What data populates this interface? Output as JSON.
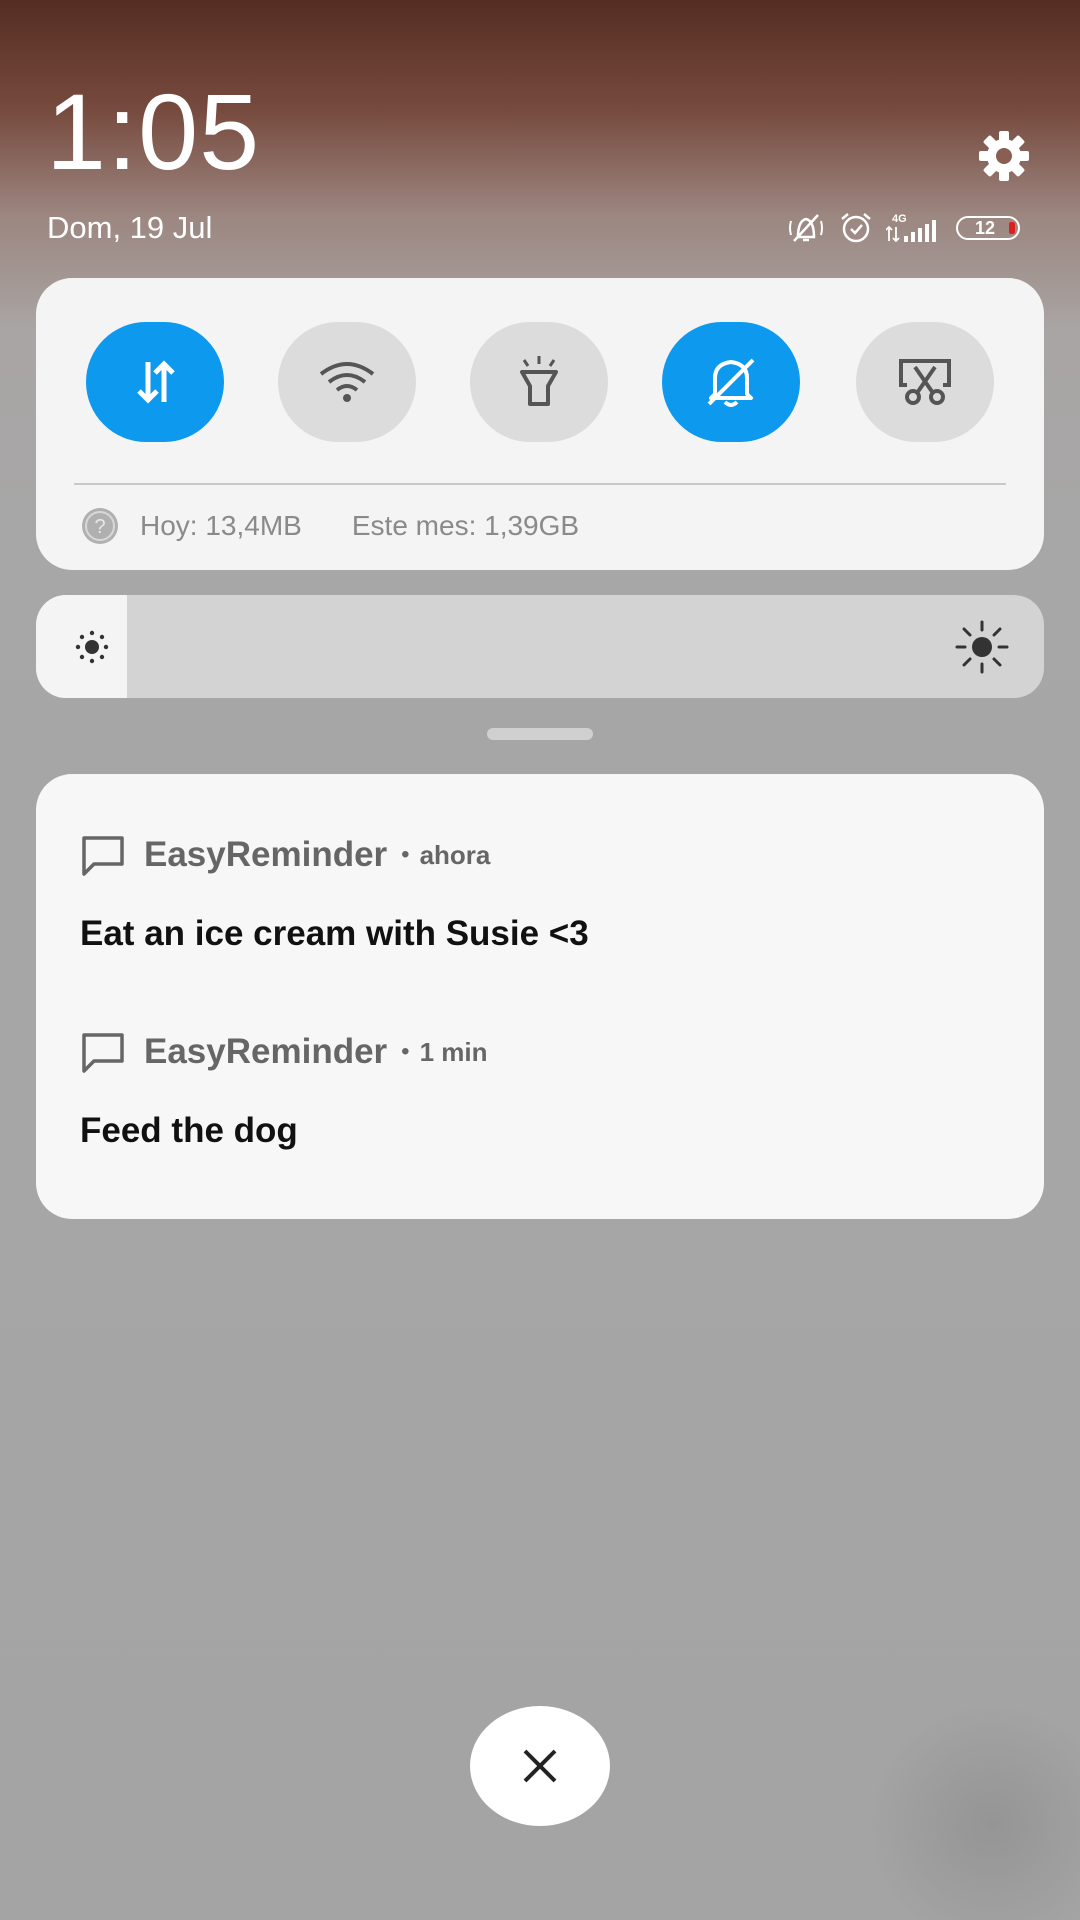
{
  "header": {
    "time": "1:05",
    "date": "Dom, 19 Jul",
    "network_type": "4G",
    "battery_level": "12",
    "icons": [
      "settings-icon",
      "vibrate-silent-icon",
      "alarm-icon",
      "signal-icon",
      "battery-icon"
    ]
  },
  "quick_settings": {
    "tiles": [
      {
        "name": "mobile-data",
        "icon": "data-arrows-icon",
        "active": true
      },
      {
        "name": "wifi",
        "icon": "wifi-icon",
        "active": false
      },
      {
        "name": "flashlight",
        "icon": "flashlight-icon",
        "active": false
      },
      {
        "name": "silent",
        "icon": "bell-off-icon",
        "active": true
      },
      {
        "name": "screenshot",
        "icon": "screenshot-scissors-icon",
        "active": false
      }
    ],
    "data_usage": {
      "today": "Hoy: 13,4MB",
      "month": "Este mes: 1,39GB"
    }
  },
  "brightness": {
    "level": 0.09
  },
  "notifications": [
    {
      "app": "EasyReminder",
      "separator": "•",
      "time": "ahora",
      "text": "Eat an ice cream with Susie <3"
    },
    {
      "app": "EasyReminder",
      "separator": "•",
      "time": "1 min",
      "text": "Feed the dog"
    }
  ],
  "colors": {
    "accent": "#0d99ee",
    "tile_off": "#dcdcdc",
    "panel": "#f4f4f4"
  }
}
